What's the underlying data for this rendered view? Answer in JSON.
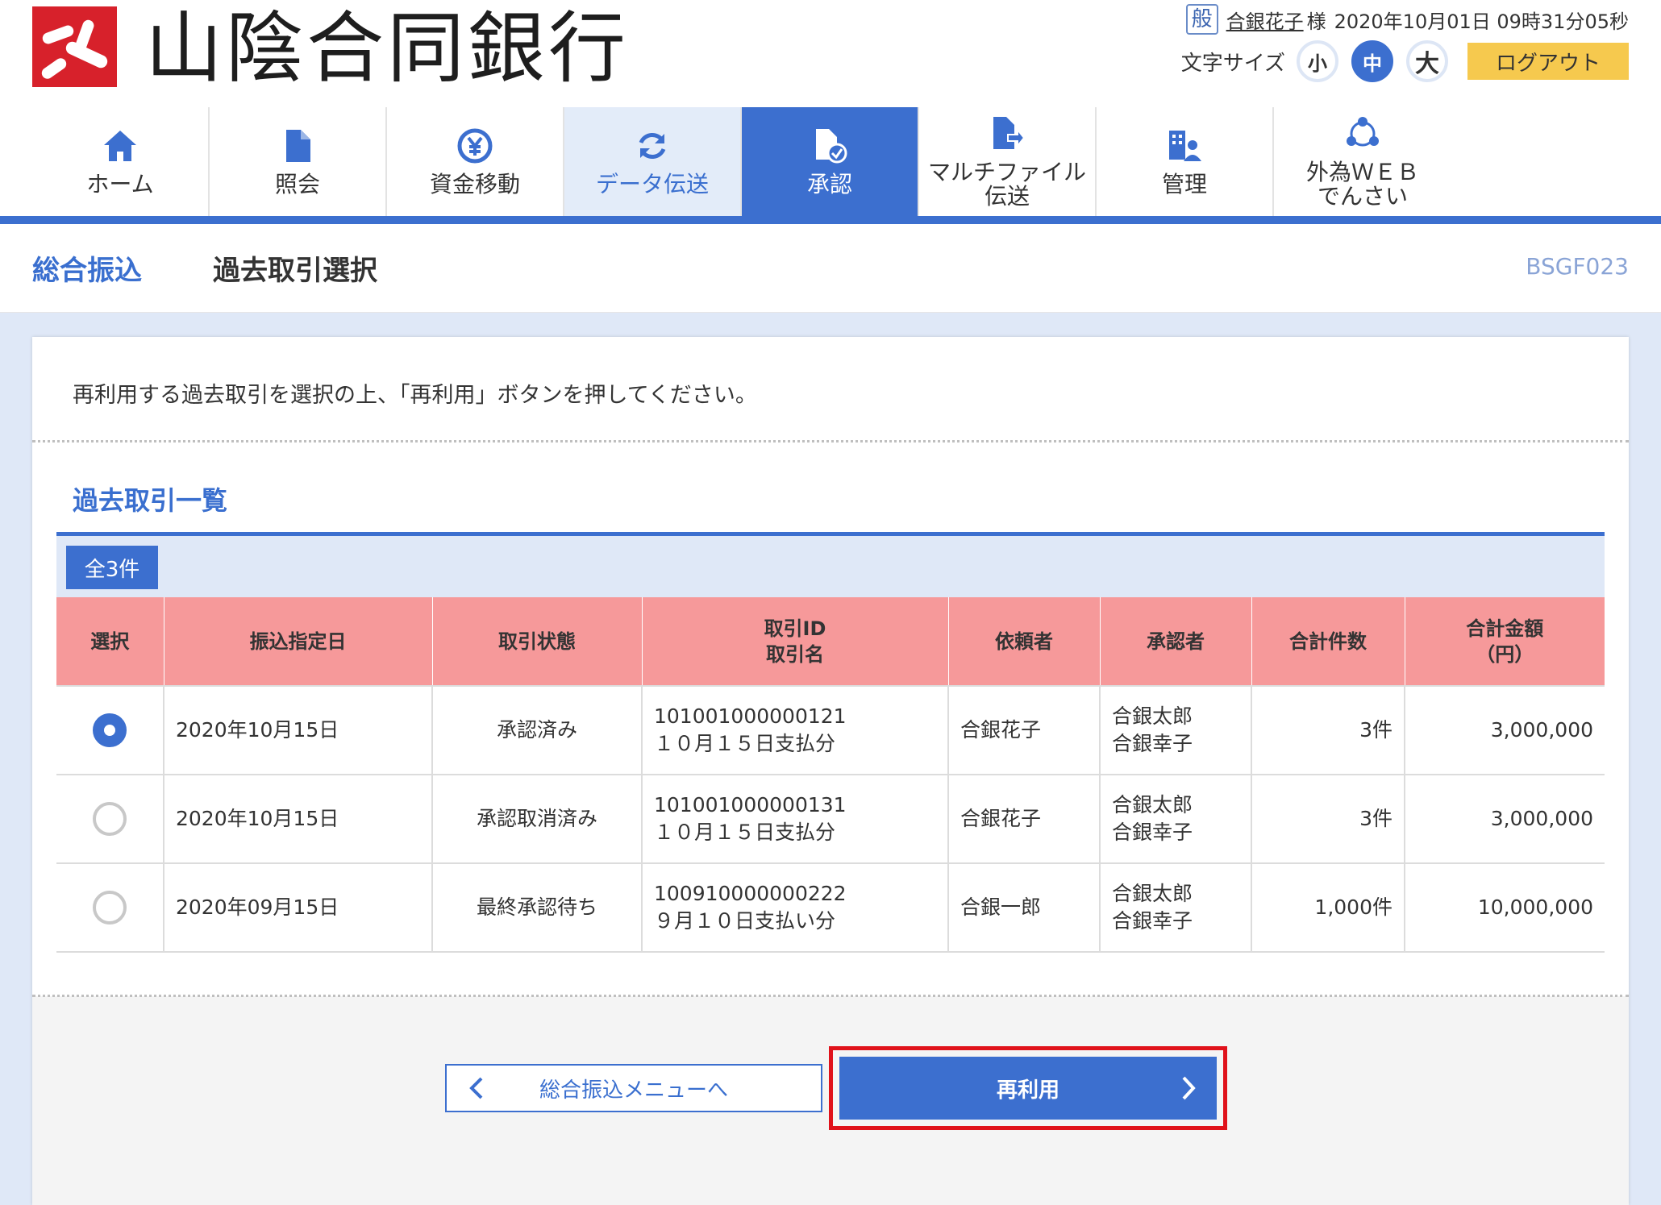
{
  "bank": {
    "name": "山陰合同銀行"
  },
  "user": {
    "type_badge": "般",
    "name": "合銀花子",
    "honorific": "様",
    "datetime": "2020年10月01日 09時31分05秒"
  },
  "font_size": {
    "label": "文字サイズ",
    "small": "小",
    "medium": "中",
    "large": "大",
    "selected": "中"
  },
  "logout_label": "ログアウト",
  "nav": {
    "home": "ホーム",
    "inquiry": "照会",
    "fund_transfer": "資金移動",
    "data_transmission": "データ伝送",
    "approval": "承認",
    "multifile_line1": "マルチファイル",
    "multifile_line2": "伝送",
    "admin": "管理",
    "forex_line1": "外為ＷＥＢ",
    "forex_line2": "でんさい",
    "active": "承認"
  },
  "page": {
    "title_main": "総合振込",
    "title_sub": "過去取引選択",
    "code": "BSGF023",
    "instruction": "再利用する過去取引を選択の上、「再利用」ボタンを押してください。"
  },
  "section": {
    "title": "過去取引一覧",
    "count": "全3件"
  },
  "table": {
    "headers": {
      "select": "選択",
      "date": "振込指定日",
      "status": "取引状態",
      "id_line1": "取引ID",
      "id_line2": "取引名",
      "requester": "依頼者",
      "approver": "承認者",
      "count": "合計件数",
      "amount_line1": "合計金額",
      "amount_line2": "（円）"
    },
    "rows": [
      {
        "selected": true,
        "date": "2020年10月15日",
        "status": "承認済み",
        "id": "101001000000121",
        "name": "１０月１５日支払分",
        "requester": "合銀花子",
        "approver1": "合銀太郎",
        "approver2": "合銀幸子",
        "count": "3件",
        "amount": "3,000,000"
      },
      {
        "selected": false,
        "date": "2020年10月15日",
        "status": "承認取消済み",
        "id": "101001000000131",
        "name": "１０月１５日支払分",
        "requester": "合銀花子",
        "approver1": "合銀太郎",
        "approver2": "合銀幸子",
        "count": "3件",
        "amount": "3,000,000"
      },
      {
        "selected": false,
        "date": "2020年09月15日",
        "status": "最終承認待ち",
        "id": "100910000000222",
        "name": "９月１０日支払い分",
        "requester": "合銀一郎",
        "approver1": "合銀太郎",
        "approver2": "合銀幸子",
        "count": "1,000件",
        "amount": "10,000,000"
      }
    ]
  },
  "buttons": {
    "back": "総合振込メニューへ",
    "reuse": "再利用"
  },
  "colors": {
    "primary": "#3c6fcf",
    "header_row": "#f6999a",
    "logout": "#f6c94e",
    "highlight": "#e0121b",
    "logo_red": "#d7212b"
  }
}
